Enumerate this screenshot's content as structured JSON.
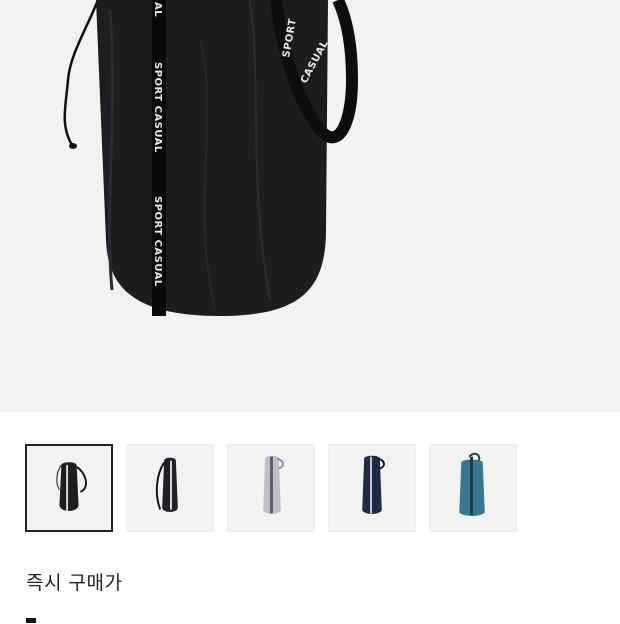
{
  "product": {
    "image_alt": "SPORT CASUAL black drawstring bag",
    "strap_text": "SPORT CASUAL",
    "colors": [
      "#1d1e20",
      "#1f2124",
      "#bcc1c4",
      "#1f2a45",
      "#3b7690"
    ],
    "selected_color_index": 0
  },
  "pricing": {
    "label": "즉시 구매가",
    "value": ""
  }
}
